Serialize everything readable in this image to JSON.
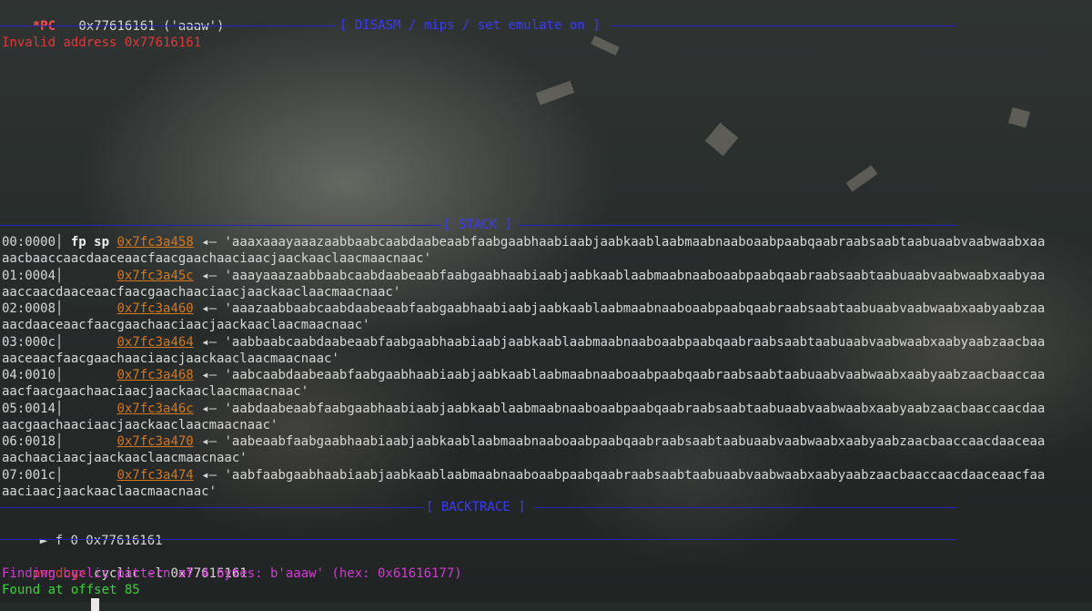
{
  "registers": {
    "pc_label": "*PC",
    "pc_value": "0x77616161 ('aaaw')"
  },
  "disasm": {
    "banner": "[ DISASM / mips / set emulate on ]",
    "error": "Invalid address 0x77616161"
  },
  "stack": {
    "banner": "[ STACK ]",
    "rows": [
      {
        "offset": "00:0000",
        "regs": "fp sp",
        "address": "0x7fc3a458",
        "arrow": "◂—",
        "value_line1": "'aaaxaaayaaazaabbaabcaabdaabeaabfaabgaabhaabiaabjaabkaablaabmaabnaaboaabpaabqaabraabsaabtaabuaabvaabwaabxaa",
        "value_line2": "aacbaaccaacdaaceaacfaacgaachaaciaacjaackaaclaacmaacnaac'"
      },
      {
        "offset": "01:0004",
        "regs": "",
        "address": "0x7fc3a45c",
        "arrow": "◂—",
        "value_line1": "'aaayaaazaabbaabcaabdaabeaabfaabgaabhaabiaabjaabkaablaabmaabnaaboaabpaabqaabraabsaabtaabuaabvaabwaabxaabyaa",
        "value_line2": "aaccaacdaaceaacfaacgaachaaciaacjaackaaclaacmaacnaac'"
      },
      {
        "offset": "02:0008",
        "regs": "",
        "address": "0x7fc3a460",
        "arrow": "◂—",
        "value_line1": "'aaazaabbaabcaabdaabeaabfaabgaabhaabiaabjaabkaablaabmaabnaaboaabpaabqaabraabsaabtaabuaabvaabwaabxaabyaabzaa",
        "value_line2": "aacdaaceaacfaacgaachaaciaacjaackaaclaacmaacnaac'"
      },
      {
        "offset": "03:000c",
        "regs": "",
        "address": "0x7fc3a464",
        "arrow": "◂—",
        "value_line1": "'aabbaabcaabdaabeaabfaabgaabhaabiaabjaabkaablaabmaabnaaboaabpaabqaabraabsaabtaabuaabvaabwaabxaabyaabzaacbaa",
        "value_line2": "aaceaacfaacgaachaaciaacjaackaaclaacmaacnaac'"
      },
      {
        "offset": "04:0010",
        "regs": "",
        "address": "0x7fc3a468",
        "arrow": "◂—",
        "value_line1": "'aabcaabdaabeaabfaabgaabhaabiaabjaabkaablaabmaabnaaboaabpaabqaabraabsaabtaabuaabvaabwaabxaabyaabzaacbaaccaa",
        "value_line2": "aacfaacgaachaaciaacjaackaaclaacmaacnaac'"
      },
      {
        "offset": "05:0014",
        "regs": "",
        "address": "0x7fc3a46c",
        "arrow": "◂—",
        "value_line1": "'aabdaabeaabfaabgaabhaabiaabjaabkaablaabmaabnaaboaabpaabqaabraabsaabtaabuaabvaabwaabxaabyaabzaacbaaccaacdaa",
        "value_line2": "aacgaachaaciaacjaackaaclaacmaacnaac'"
      },
      {
        "offset": "06:0018",
        "regs": "",
        "address": "0x7fc3a470",
        "arrow": "◂—",
        "value_line1": "'aabeaabfaabgaabhaabiaabjaabkaablaabmaabnaaboaabpaabqaabraabsaabtaabuaabvaabwaabxaabyaabzaacbaaccaacdaaceaa",
        "value_line2": "aachaaciaacjaackaaclaacmaacnaac'"
      },
      {
        "offset": "07:001c",
        "regs": "",
        "address": "0x7fc3a474",
        "arrow": "◂—",
        "value_line1": "'aabfaabgaabhaabiaabjaabkaablaabmaabnaaboaabpaabqaabraabsaabtaabuaabvaabwaabxaabyaabzaacbaaccaacdaaceaacfaa",
        "value_line2": "aaciaacjaackaaclaacmaacnaac'"
      }
    ]
  },
  "backtrace": {
    "banner": "[ BACKTRACE ]",
    "frame_marker": "►",
    "frame": "f 0 0x77616161"
  },
  "prompt": {
    "label": "pwndbg>",
    "command": "cyclic -l 0x77616161"
  },
  "output": {
    "finding": "Finding cyclic pattern of 4 bytes: b'aaaw' (hex: 0x61616177)",
    "found": "Found at offset 85"
  },
  "colors": {
    "rule": "#2323c8",
    "banner": "#3a3aff",
    "error": "#e03838",
    "address": "#d2781e",
    "magenta": "#d23ad2",
    "green": "#3ad23a"
  }
}
